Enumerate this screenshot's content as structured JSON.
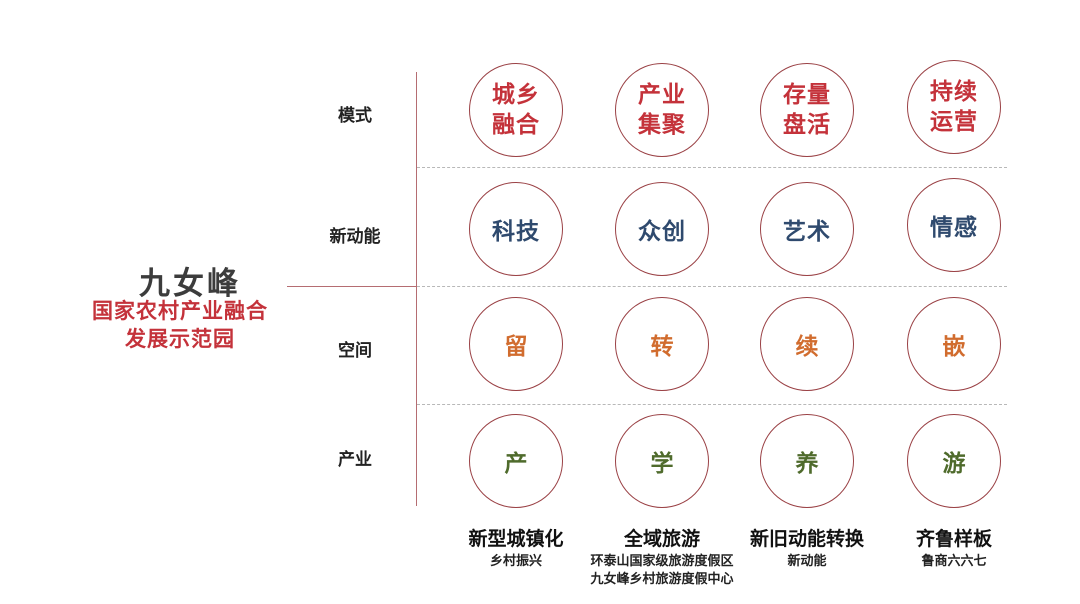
{
  "title": {
    "main": "九女峰",
    "sub_line1": "国家农村产业融合",
    "sub_line2": "发展示范园"
  },
  "rows": [
    {
      "label": "模式"
    },
    {
      "label": "新动能"
    },
    {
      "label": "空间"
    },
    {
      "label": "产业"
    }
  ],
  "grid": {
    "mode": [
      "城乡\n融合",
      "产业\n集聚",
      "存量\n盘活",
      "持续\n运营"
    ],
    "new_energy": [
      "科技",
      "众创",
      "艺术",
      "情感"
    ],
    "space": [
      "留",
      "转",
      "续",
      "嵌"
    ],
    "industry": [
      "产",
      "学",
      "养",
      "游"
    ]
  },
  "columns": [
    {
      "title": "新型城镇化",
      "subtitle_lines": [
        "乡村振兴"
      ]
    },
    {
      "title": "全域旅游",
      "subtitle_lines": [
        "环泰山国家级旅游度假区",
        "九女峰乡村旅游度假中心"
      ]
    },
    {
      "title": "新旧动能转换",
      "subtitle_lines": [
        "新动能"
      ]
    },
    {
      "title": "齐鲁样板",
      "subtitle_lines": [
        "鲁商六六七"
      ]
    }
  ],
  "colors": {
    "accent_red": "#c4323a",
    "circle_border": "#9a4145",
    "new_energy_text": "#2f4a6e",
    "space_text": "#d16c2e",
    "industry_text": "#4f6b2c",
    "divider_line": "#b56d72",
    "dashed_line": "#b8b8b8"
  }
}
